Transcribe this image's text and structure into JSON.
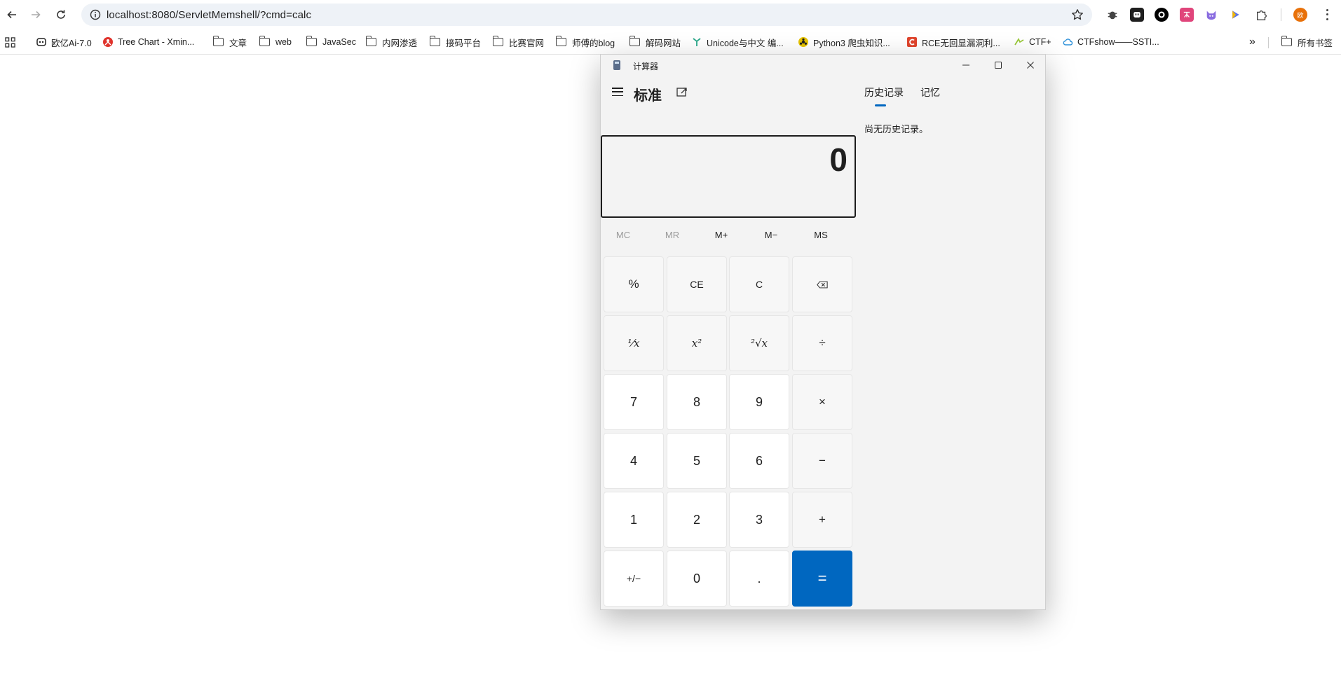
{
  "browser": {
    "url": "localhost:8080/ServletMemshell/?cmd=calc",
    "profile_initial": "欧",
    "bookmarks": [
      {
        "label": "欧亿Ai-7.0",
        "icon": "robot-icon"
      },
      {
        "label": "Tree Chart - Xmin...",
        "icon": "tree-chart-icon"
      },
      {
        "label": "文章",
        "icon": "folder-icon"
      },
      {
        "label": "web",
        "icon": "folder-icon"
      },
      {
        "label": "JavaSec",
        "icon": "folder-icon"
      },
      {
        "label": "内网渗透",
        "icon": "folder-icon"
      },
      {
        "label": "接码平台",
        "icon": "folder-icon"
      },
      {
        "label": "比赛官网",
        "icon": "folder-icon"
      },
      {
        "label": "师傅的blog",
        "icon": "folder-icon"
      },
      {
        "label": "解码网站",
        "icon": "folder-icon"
      },
      {
        "label": "Unicode与中文 编...",
        "icon": "unicode-icon"
      },
      {
        "label": "Python3 爬虫知识...",
        "icon": "biohazard-icon"
      },
      {
        "label": "RCE无回显漏洞利...",
        "icon": "c-icon"
      },
      {
        "label": "CTF+",
        "icon": "ctf-icon"
      },
      {
        "label": "CTFshow——SSTI...",
        "icon": "cloud-icon"
      }
    ],
    "all_bookmarks_label": "所有书签",
    "more_bookmarks": "»"
  },
  "calculator": {
    "window_title": "计算器",
    "mode_title": "标准",
    "display_value": "0",
    "memory_buttons": [
      "MC",
      "MR",
      "M+",
      "M−",
      "MS"
    ],
    "memory_disabled": [
      "MC",
      "MR"
    ],
    "keys": [
      [
        "%",
        "CE",
        "C",
        "⌫"
      ],
      [
        "¹⁄x",
        "x²",
        "²√x",
        "÷"
      ],
      [
        "7",
        "8",
        "9",
        "×"
      ],
      [
        "4",
        "5",
        "6",
        "−"
      ],
      [
        "1",
        "2",
        "3",
        "+"
      ],
      [
        "+/−",
        "0",
        ".",
        "="
      ]
    ],
    "tabs": {
      "history": "历史记录",
      "memory": "记忆"
    },
    "history_empty": "尚无历史记录。",
    "accent_color": "#0067c0"
  }
}
